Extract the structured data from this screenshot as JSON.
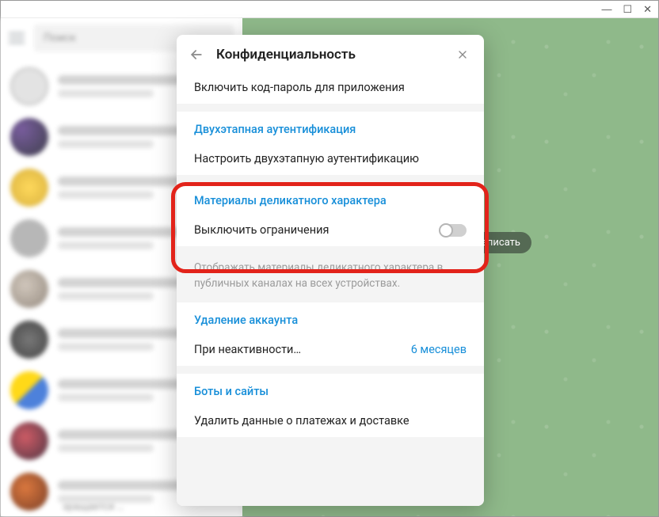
{
  "window": {
    "minimize": "—",
    "maximize": "☐",
    "close": "✕"
  },
  "sidebar": {
    "search_placeholder": "Поиск",
    "bottom_fragment": "зращается …"
  },
  "chat_area": {
    "write_label": "написать"
  },
  "modal": {
    "title": "Конфиденциальность",
    "passcode_row": "Включить код-пароль для приложения",
    "two_step": {
      "heading": "Двухэтапная аутентификация",
      "row": "Настроить двухэтапную аутентификацию"
    },
    "sensitive": {
      "heading": "Материалы деликатного характера",
      "toggle_label": "Выключить ограничения",
      "toggle_on": false,
      "desc": "Отображать материалы деликатного характера в публичных каналах на всех устройствах."
    },
    "delete_account": {
      "heading": "Удаление аккаунта",
      "row_label": "При неактивности…",
      "row_value": "6 месяцев"
    },
    "bots": {
      "heading": "Боты и сайты",
      "row": "Удалить данные о платежах и доставке"
    }
  }
}
